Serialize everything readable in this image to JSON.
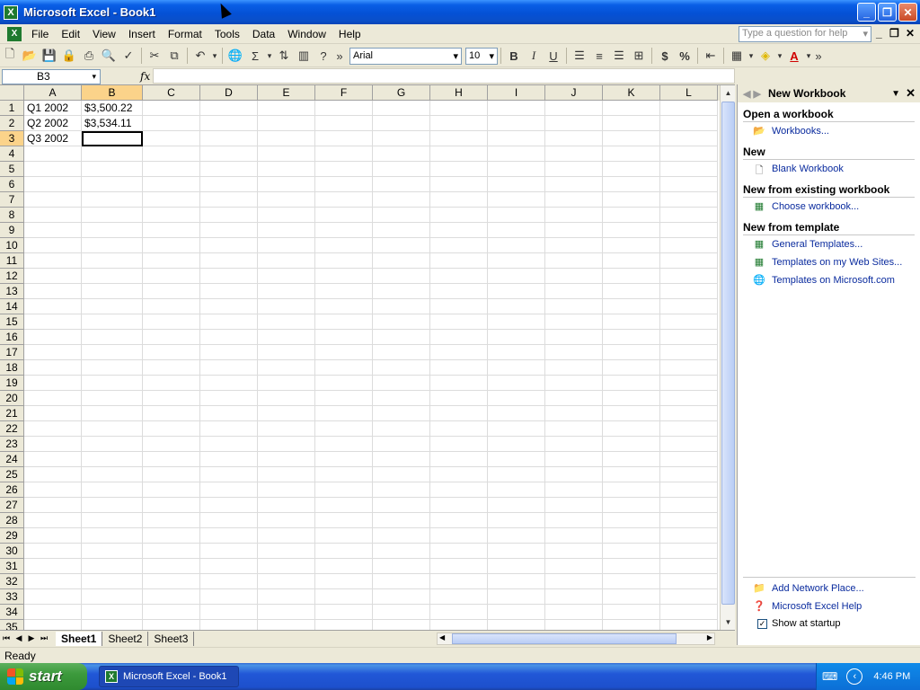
{
  "window": {
    "title": "Microsoft Excel - Book1"
  },
  "menubar": {
    "items": [
      "File",
      "Edit",
      "View",
      "Insert",
      "Format",
      "Tools",
      "Data",
      "Window",
      "Help"
    ],
    "help_placeholder": "Type a question for help"
  },
  "toolbar": {
    "font_name": "Arial",
    "font_size": "10",
    "buttons": [
      "new-icon",
      "open-icon",
      "save-icon",
      "permission-icon",
      "print-icon",
      "print-preview-icon",
      "spelling-icon",
      "cut-icon",
      "copy-icon",
      "undo-icon",
      "hyperlink-icon",
      "autosum-icon",
      "sort-ascending-icon",
      "chart-wizard-icon",
      "help-icon",
      "bold-icon",
      "italic-icon",
      "underline-icon",
      "align-left-icon",
      "center-icon",
      "align-right-icon",
      "merge-center-icon",
      "currency-icon",
      "percent-icon",
      "decrease-indent-icon",
      "borders-icon",
      "fill-color-icon",
      "font-color-icon"
    ],
    "bold_label": "B",
    "italic_label": "I",
    "underline_label": "U",
    "currency_label": "$",
    "percent_label": "%",
    "sum_label": "Σ"
  },
  "formula_bar": {
    "name_box": "B3",
    "fx_label": "fx",
    "formula": ""
  },
  "grid": {
    "columns": [
      "A",
      "B",
      "C",
      "D",
      "E",
      "F",
      "G",
      "H",
      "I",
      "J",
      "K",
      "L"
    ],
    "rows": [
      "1",
      "2",
      "3",
      "4",
      "5",
      "6",
      "7",
      "8",
      "9",
      "10",
      "11",
      "12",
      "13",
      "14",
      "15",
      "16",
      "17",
      "18",
      "19",
      "20",
      "21",
      "22",
      "23",
      "24",
      "25",
      "26",
      "27",
      "28",
      "29",
      "30",
      "31",
      "32",
      "33",
      "34",
      "35"
    ],
    "cells": {
      "A1": "Q1 2002",
      "B1": "$3,500.22",
      "A2": "Q2 2002",
      "B2": "$3,534.11",
      "A3": "Q3 2002"
    },
    "active_cell": "B3"
  },
  "sheet_tabs": [
    "Sheet1",
    "Sheet2",
    "Sheet3"
  ],
  "status": {
    "text": "Ready"
  },
  "task_pane": {
    "title": "New Workbook",
    "sections": [
      {
        "title": "Open a workbook",
        "links": [
          {
            "label": "Workbooks...",
            "icon": "folder-open-icon"
          }
        ]
      },
      {
        "title": "New",
        "links": [
          {
            "label": "Blank Workbook",
            "icon": "blank-document-icon"
          }
        ]
      },
      {
        "title": "New from existing workbook",
        "links": [
          {
            "label": "Choose workbook...",
            "icon": "workbook-icon"
          }
        ]
      },
      {
        "title": "New from template",
        "links": [
          {
            "label": "General Templates...",
            "icon": "template-icon"
          },
          {
            "label": "Templates on my Web Sites...",
            "icon": "web-template-icon"
          },
          {
            "label": "Templates on Microsoft.com",
            "icon": "globe-icon"
          }
        ]
      }
    ],
    "bottom_links": [
      {
        "label": "Add Network Place...",
        "icon": "network-place-icon"
      },
      {
        "label": "Microsoft Excel Help",
        "icon": "help-icon"
      }
    ],
    "show_at_startup": {
      "label": "Show at startup",
      "checked": true
    }
  },
  "taskbar": {
    "start_label": "start",
    "items": [
      "Microsoft Excel - Book1"
    ],
    "clock": "4:46 PM"
  }
}
